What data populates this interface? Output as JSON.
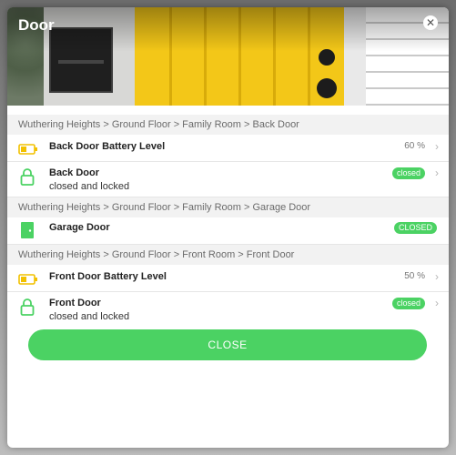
{
  "dialog": {
    "title": "Door",
    "close_icon": "close-icon",
    "close_button_label": "CLOSE",
    "accent_color": "#4bd263"
  },
  "groups": [
    {
      "breadcrumb": "Wuthering Heights > Ground Floor > Family Room > Back Door",
      "items": [
        {
          "name": "Back Door Battery Level",
          "value": "60 %",
          "icon": "battery-icon"
        },
        {
          "name": "Back Door",
          "secondary": "closed and locked",
          "status": "closed",
          "icon": "lock-icon"
        }
      ]
    },
    {
      "breadcrumb": "Wuthering Heights > Ground Floor > Family Room > Garage Door",
      "items": [
        {
          "name": "Garage Door",
          "status": "CLOSED",
          "icon": "door-icon"
        }
      ]
    },
    {
      "breadcrumb": "Wuthering Heights > Ground Floor > Front Room > Front Door",
      "items": [
        {
          "name": "Front Door Battery Level",
          "value": "50 %",
          "icon": "battery-icon"
        },
        {
          "name": "Front Door",
          "secondary": "closed and locked",
          "status": "closed",
          "icon": "lock-icon"
        }
      ]
    }
  ]
}
